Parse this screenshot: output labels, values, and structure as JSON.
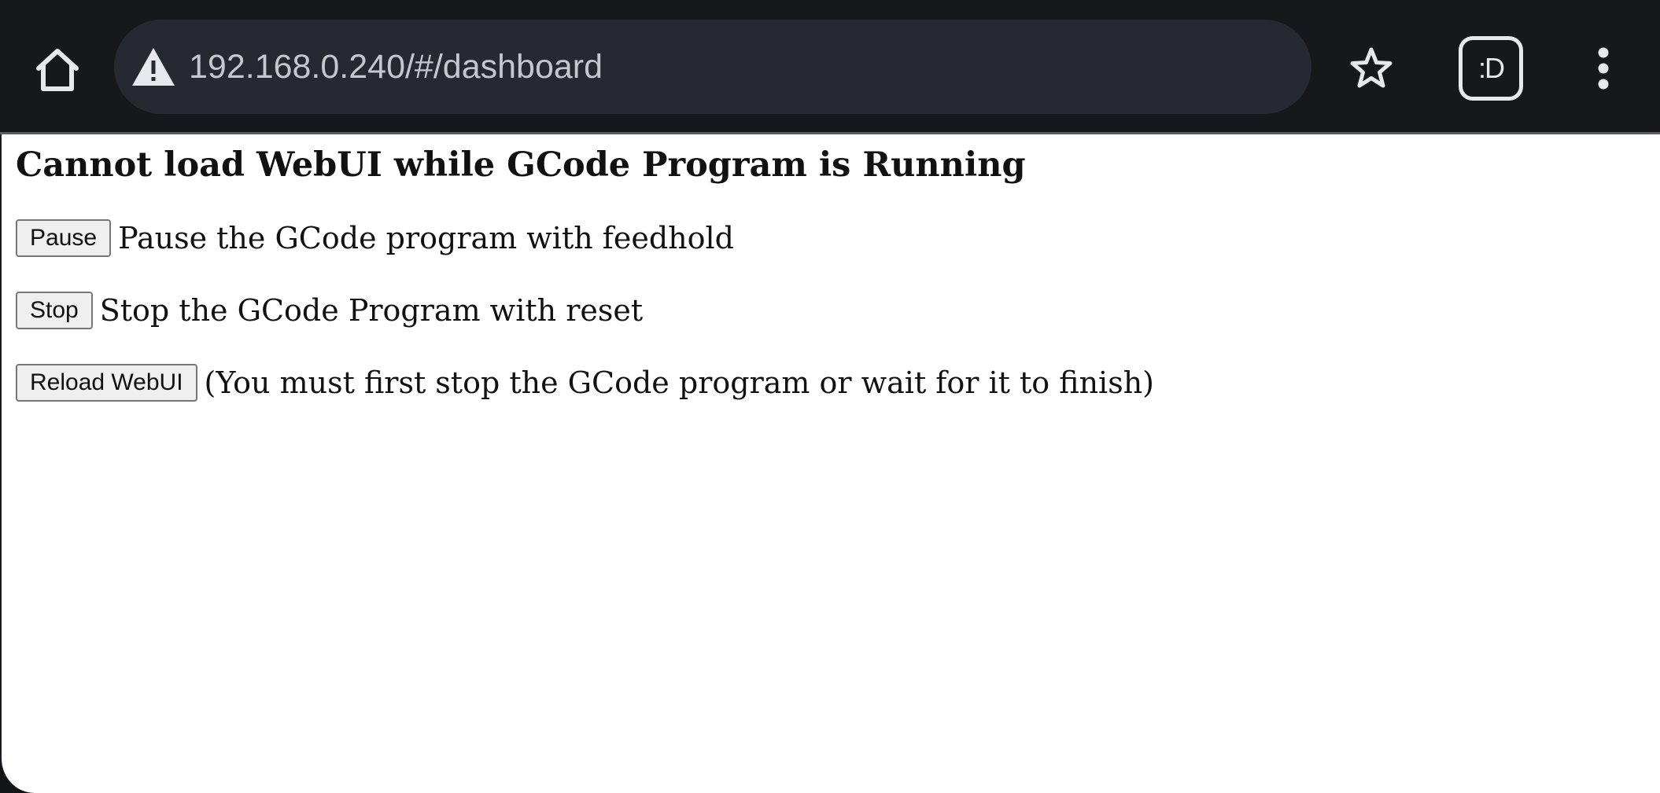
{
  "browser": {
    "url": "192.168.0.240/#/dashboard",
    "extension_badge": ":D",
    "icons": {
      "home": "home-icon",
      "security_warning": "warning-triangle-icon",
      "bookmark": "star-icon",
      "extension": "extension-icon",
      "menu": "kebab-menu-icon"
    }
  },
  "page": {
    "title": "Cannot load WebUI while GCode Program is Running",
    "actions": [
      {
        "button": "Pause",
        "description": "Pause the GCode program with feedhold"
      },
      {
        "button": "Stop",
        "description": "Stop the GCode Program with reset"
      },
      {
        "button": "Reload WebUI",
        "description": "(You must first stop the GCode program or wait for it to finish)"
      }
    ]
  },
  "colors": {
    "toolbar_bg": "#16181c",
    "omnibox_bg": "#262931",
    "page_bg": "#ffffff",
    "button_bg": "#efefef"
  }
}
